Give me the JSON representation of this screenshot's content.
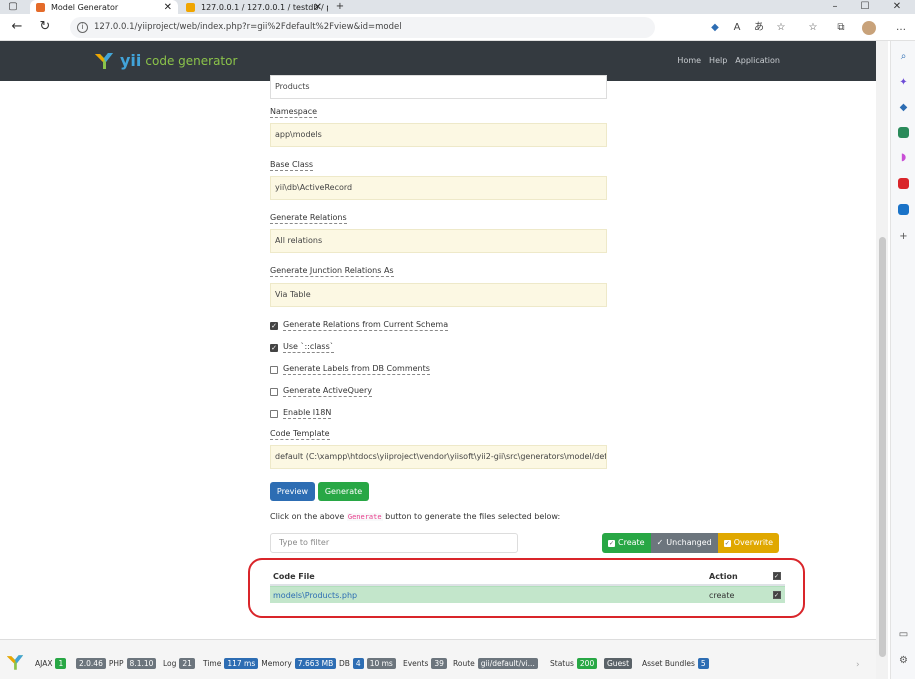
{
  "browser": {
    "tabs": [
      {
        "title": "Model Generator",
        "active": true,
        "favicon_color": "#e46b2a"
      },
      {
        "title": "127.0.0.1 / 127.0.0.1 / testdb / p",
        "active": false,
        "favicon_color": "#f0a500"
      }
    ],
    "new_tab": "+",
    "url": "127.0.0.1/yiiproject/web/index.php?r=gii%2Fdefault%2Fview&id=model",
    "window_controls": [
      "–",
      "☐",
      "✕"
    ]
  },
  "gii_header": {
    "logo_yii": "yii",
    "logo_text": "code generator",
    "nav": [
      "Home",
      "Help",
      "Application"
    ]
  },
  "form": {
    "table_name_value": "Products",
    "namespace_label": "Namespace",
    "namespace_value": "app\\models",
    "base_class_label": "Base Class",
    "base_class_value": "yii\\db\\ActiveRecord",
    "gen_relations_label": "Generate Relations",
    "gen_relations_value": "All relations",
    "junction_label": "Generate Junction Relations As",
    "junction_value": "Via Table",
    "checkboxes": [
      {
        "label": "Generate Relations from Current Schema",
        "checked": true
      },
      {
        "label": "Use `::class`",
        "checked": true
      },
      {
        "label": "Generate Labels from DB Comments",
        "checked": false
      },
      {
        "label": "Generate ActiveQuery",
        "checked": false
      },
      {
        "label": "Enable I18N",
        "checked": false
      }
    ],
    "code_template_label": "Code Template",
    "code_template_value": "default (C:\\xampp\\htdocs\\yiiproject\\vendor\\yiisoft\\yii2-gii\\src\\generators\\model/def...",
    "preview_button": "Preview",
    "generate_button": "Generate"
  },
  "results": {
    "hint_before": "Click on the above ",
    "hint_code": "Generate",
    "hint_after": " button to generate the files selected below:",
    "filter_placeholder": "Type to filter",
    "legend": {
      "create": "Create",
      "unchanged": "Unchanged",
      "overwrite": "Overwrite"
    },
    "table": {
      "headers": {
        "file": "Code File",
        "action": "Action"
      },
      "rows": [
        {
          "file": "models\\Products.php",
          "action": "create",
          "checked": true
        }
      ]
    }
  },
  "debug_toolbar": {
    "ajax_label": "AJAX",
    "ajax_count": "1",
    "version": "2.0.46",
    "php_label": "PHP",
    "php_version": "8.1.10",
    "log_label": "Log",
    "log_count": "21",
    "time_label": "Time",
    "time_value": "117 ms",
    "memory_label": "Memory",
    "memory_value": "7.663 MB",
    "db_label": "DB",
    "db_count": "4",
    "db_time": "10 ms",
    "events_label": "Events",
    "events_count": "39",
    "route_label": "Route",
    "route_value": "gii/default/vi...",
    "status_label": "Status",
    "status_value": "200",
    "user_value": "Guest",
    "assets_label": "Asset Bundles",
    "assets_count": "5"
  }
}
